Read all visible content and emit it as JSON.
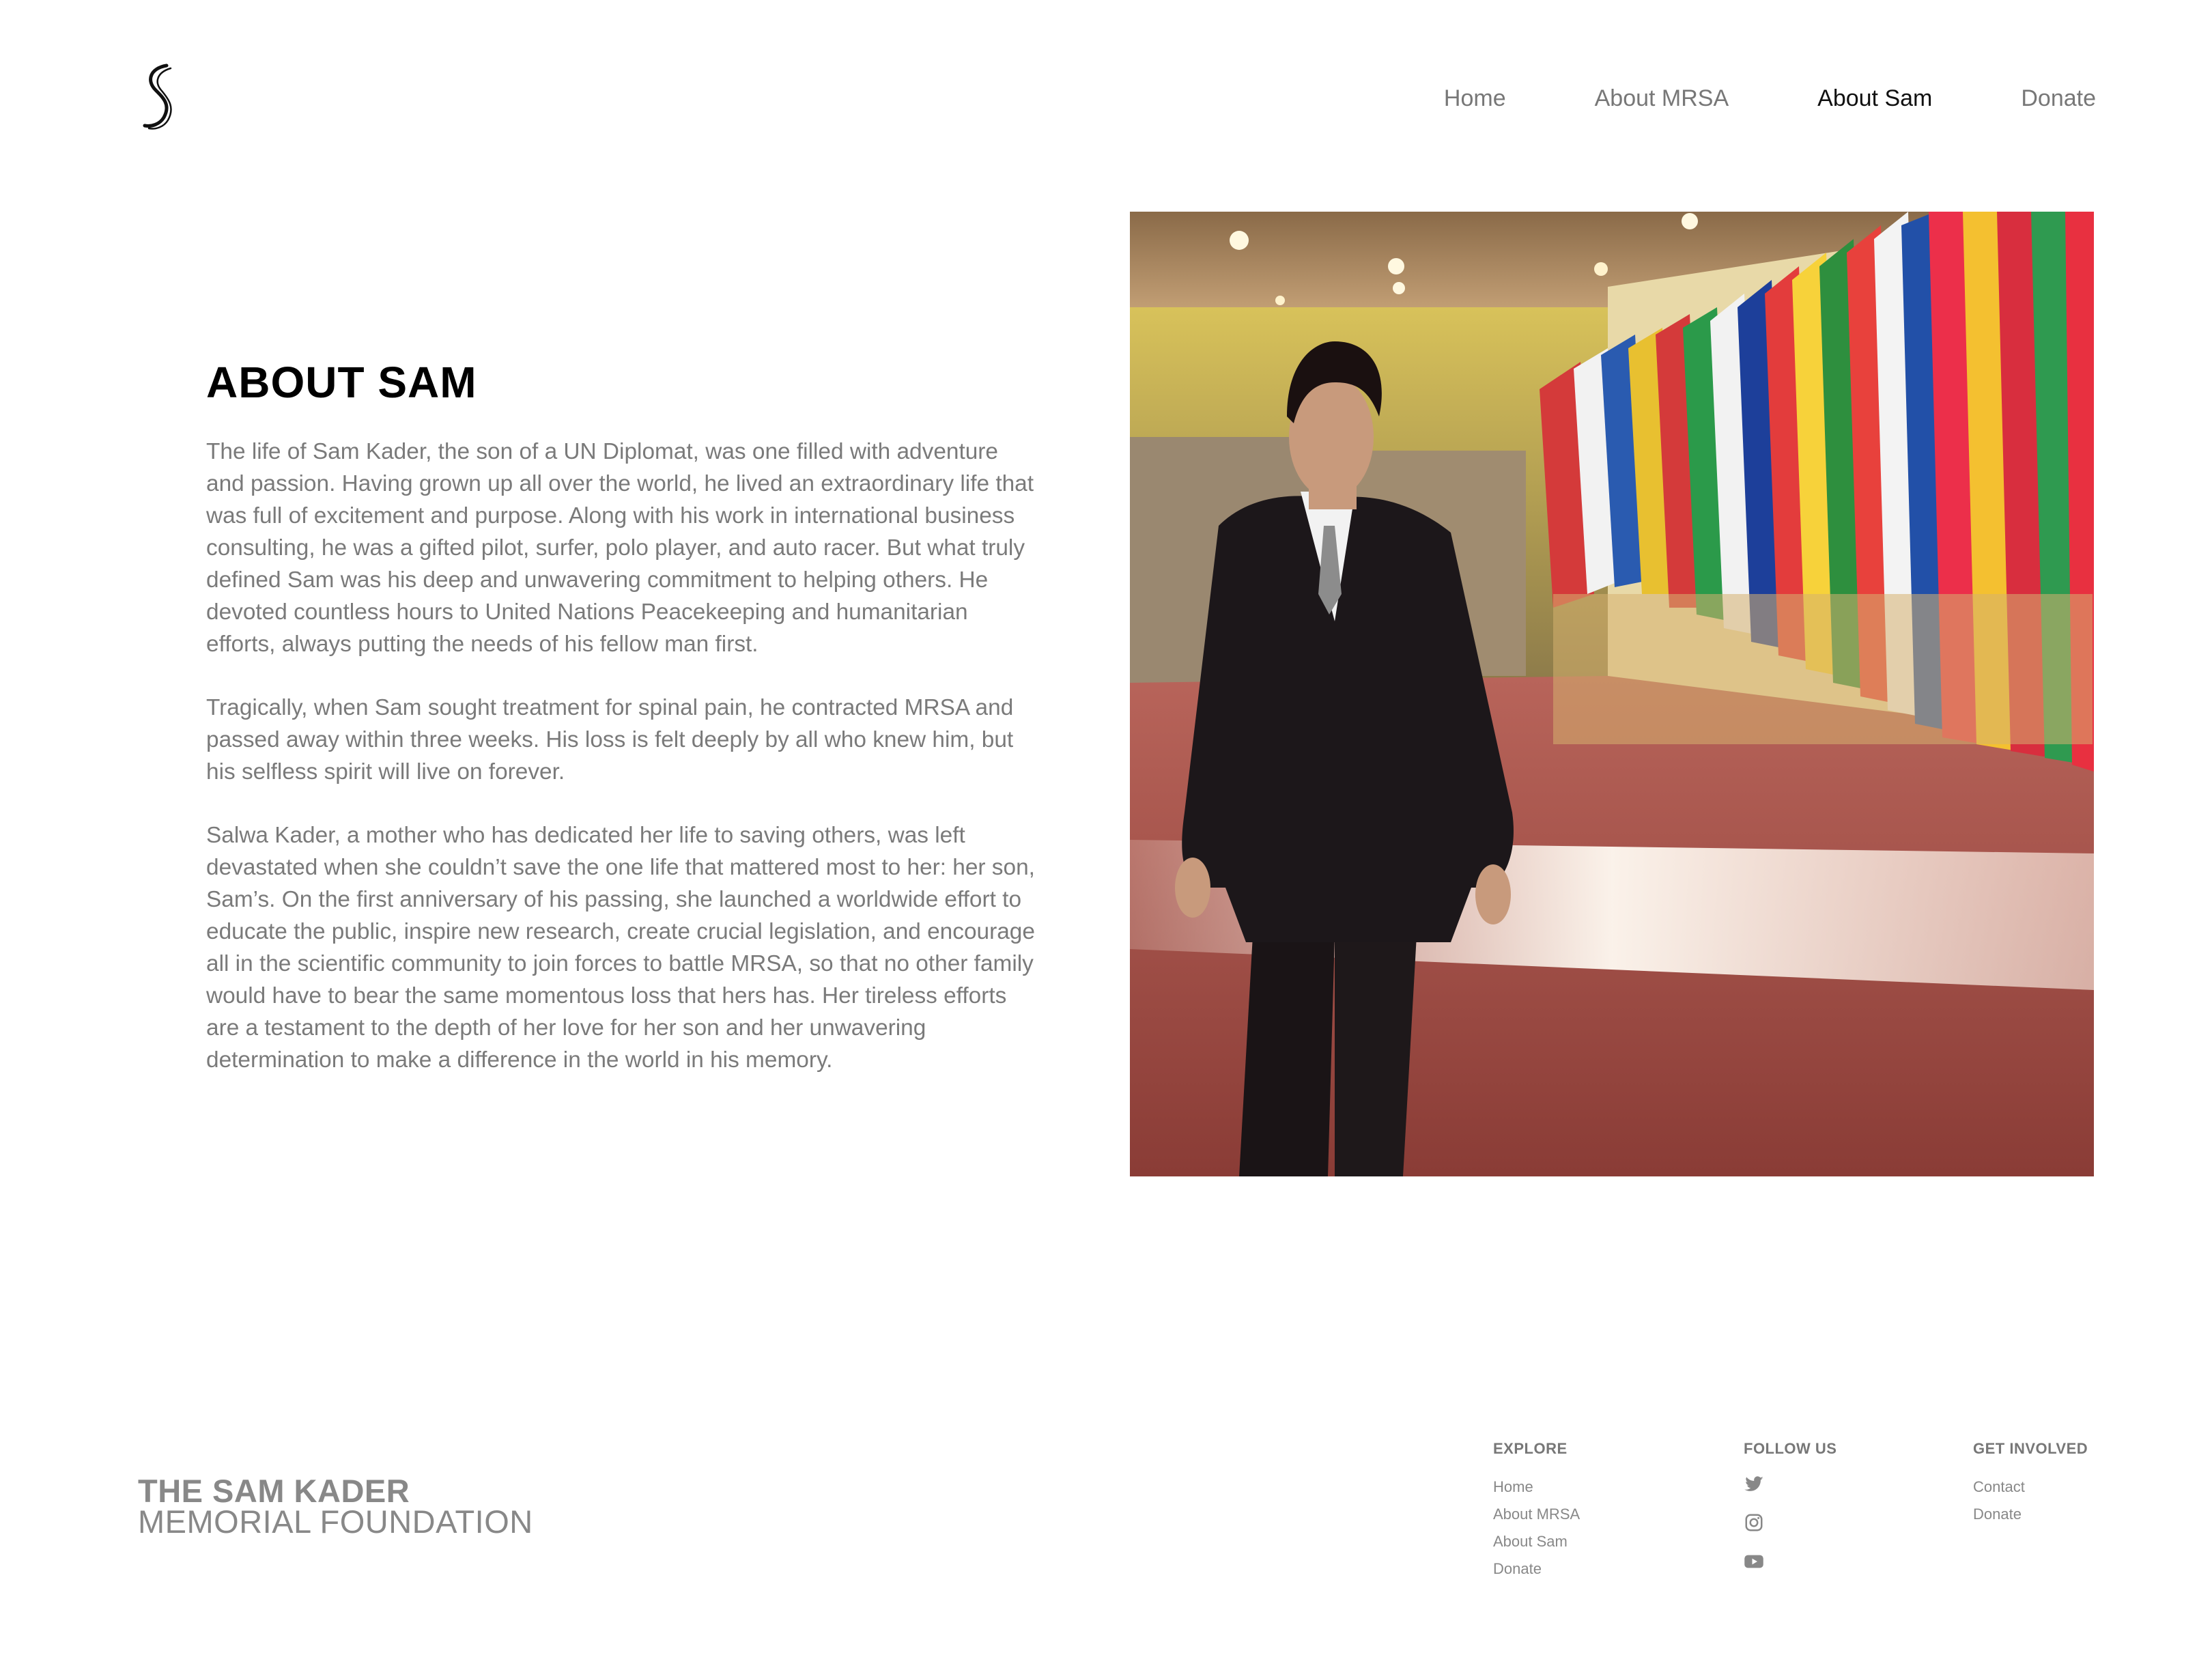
{
  "nav": {
    "items": [
      {
        "label": "Home"
      },
      {
        "label": "About MRSA"
      },
      {
        "label": "About Sam"
      },
      {
        "label": "Donate"
      }
    ]
  },
  "logo": {
    "icon": "s-logo-icon"
  },
  "about": {
    "title": "ABOUT SAM",
    "paragraphs": [
      "The life of Sam Kader, the son of a UN Diplomat, was one filled with adventure and passion. Having grown up all over the world, he lived an extraordinary life that was full of excitement and purpose. Along with his work in international business consulting, he was a gifted pilot, surfer, polo player, and auto racer. But what truly defined Sam was his deep and unwavering commitment to helping others. He devoted countless hours to United Nations Peacekeeping and humanitarian efforts, always putting the needs of his fellow man first.",
      "Tragically, when Sam sought treatment for spinal pain, he contracted MRSA and passed away within three weeks. His loss is felt deeply by all who knew him, but his selfless spirit will live on forever.",
      "Salwa Kader, a mother who has dedicated her life to saving others, was left devastated when she couldn’t save the one life that mattered most to her: her son, Sam’s. On the first anniversary of his passing, she launched a worldwide effort to educate the public, inspire new research, create crucial legislation, and encourage all in the scientific community to join forces to battle MRSA, so that no other family would have to bear the same momentous loss that hers has. Her tireless efforts are a testament to the depth of her love for her son and her unwavering determination to make a difference in the world in his memory."
    ]
  },
  "footer": {
    "foundation_line1": "THE SAM KADER",
    "foundation_line2": "MEMORIAL FOUNDATION",
    "explore": {
      "heading": "EXPLORE",
      "links": [
        "Home",
        "About MRSA",
        "About Sam",
        "Donate"
      ]
    },
    "follow": {
      "heading": "FOLLOW US",
      "icons": [
        "twitter-icon",
        "instagram-icon",
        "youtube-icon"
      ]
    },
    "involved": {
      "heading": "GET INVOLVED",
      "links": [
        "Contact",
        "Donate"
      ]
    }
  },
  "colors": {
    "nav_text": "#777777",
    "nav_active": "#111111",
    "body_text": "#7a7a7a",
    "footer_text": "#888888"
  }
}
